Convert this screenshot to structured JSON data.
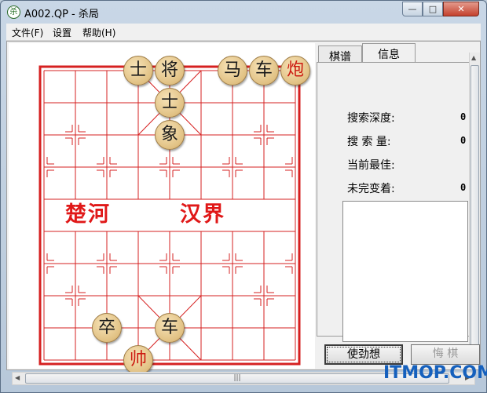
{
  "window": {
    "title": "A002.QP - 杀局",
    "icon": "chess-app-icon",
    "icon_glyph": "杀",
    "controls": {
      "minimize": "—",
      "maximize": "□",
      "close": "✕"
    }
  },
  "menu": [
    "文件(F)",
    "设置",
    "帮助(H)"
  ],
  "board": {
    "river_left": "楚河",
    "river_right": "汉界",
    "colors": {
      "line": "#d62020",
      "red_piece": "#cc1a10",
      "black_piece": "#1a1a1a"
    },
    "pieces": [
      {
        "char": "士",
        "side": "black",
        "file": 3,
        "rank": 0
      },
      {
        "char": "将",
        "side": "black",
        "file": 4,
        "rank": 0
      },
      {
        "char": "马",
        "side": "black",
        "file": 6,
        "rank": 0
      },
      {
        "char": "车",
        "side": "black",
        "file": 7,
        "rank": 0
      },
      {
        "char": "炮",
        "side": "red",
        "file": 8,
        "rank": 0
      },
      {
        "char": "士",
        "side": "black",
        "file": 4,
        "rank": 1
      },
      {
        "char": "象",
        "side": "black",
        "file": 4,
        "rank": 2
      },
      {
        "char": "卒",
        "side": "black",
        "file": 2,
        "rank": 8
      },
      {
        "char": "车",
        "side": "black",
        "file": 4,
        "rank": 8
      },
      {
        "char": "帅",
        "side": "red",
        "file": 3,
        "rank": 9
      }
    ]
  },
  "tabs": {
    "moves": "棋谱",
    "info": "信息",
    "active": "info"
  },
  "info": {
    "depth_label": "搜索深度:",
    "depth_value": "0",
    "nodes_label": "搜 索 量:",
    "nodes_value": "0",
    "best_label": "当前最佳:",
    "unfinished_label": "未完变着:",
    "unfinished_value": "0"
  },
  "buttons": {
    "hard_think": "使劲想",
    "undo": "悔  棋"
  },
  "hscroll_grip": "|||",
  "watermark": "ITMOP.COM"
}
